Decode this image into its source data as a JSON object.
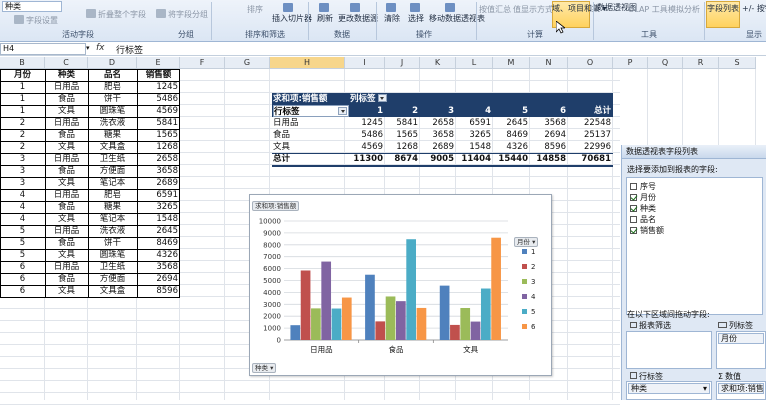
{
  "ribbon": {
    "field_name_value": "种类",
    "items": [
      {
        "label": "字段设置",
        "dim": true
      },
      {
        "label": "折叠整个字段",
        "dim": true
      },
      {
        "label": "将字段分组",
        "dim": true
      },
      {
        "label": "排序",
        "dim": true
      },
      {
        "label": "插入切片器"
      },
      {
        "label": "刷新"
      },
      {
        "label": "更改数据源"
      },
      {
        "label": "清除"
      },
      {
        "label": "选择"
      },
      {
        "label": "移动数据透视表"
      },
      {
        "label": "按值汇总",
        "dim": true
      },
      {
        "label": "值显示方式",
        "dim": true
      },
      {
        "label": "域、项目和集"
      },
      {
        "label": "数据透视图"
      },
      {
        "label": "OLAP 工具",
        "dim": true
      },
      {
        "label": "模拟分析",
        "dim": true
      },
      {
        "label": "字段列表"
      },
      {
        "label": "+/- 按钮"
      }
    ],
    "groups": [
      "活动字段",
      "分组",
      "排序和筛选",
      "数据",
      "操作",
      "计算",
      "工具",
      "显示"
    ]
  },
  "formula_bar": {
    "name_box": "H4",
    "fx": "fx",
    "content": "行标签"
  },
  "columns": [
    "B",
    "C",
    "D",
    "E",
    "F",
    "G",
    "H",
    "I",
    "J",
    "K",
    "L",
    "M",
    "N",
    "O",
    "P",
    "Q",
    "R",
    "S"
  ],
  "source_table": {
    "headers": [
      "月份",
      "种类",
      "品名",
      "销售额"
    ],
    "rows": [
      [
        "1",
        "日用品",
        "肥皂",
        "1245"
      ],
      [
        "1",
        "食品",
        "饼干",
        "5486"
      ],
      [
        "1",
        "文具",
        "圆珠笔",
        "4569"
      ],
      [
        "2",
        "日用品",
        "洗衣液",
        "5841"
      ],
      [
        "2",
        "食品",
        "糖果",
        "1565"
      ],
      [
        "2",
        "文具",
        "文具盒",
        "1268"
      ],
      [
        "3",
        "日用品",
        "卫生纸",
        "2658"
      ],
      [
        "3",
        "食品",
        "方便面",
        "3658"
      ],
      [
        "3",
        "文具",
        "笔记本",
        "2689"
      ],
      [
        "4",
        "日用品",
        "肥皂",
        "6591"
      ],
      [
        "4",
        "食品",
        "糖果",
        "3265"
      ],
      [
        "4",
        "文具",
        "笔记本",
        "1548"
      ],
      [
        "5",
        "日用品",
        "洗衣液",
        "2645"
      ],
      [
        "5",
        "食品",
        "饼干",
        "8469"
      ],
      [
        "5",
        "文具",
        "圆珠笔",
        "4326"
      ],
      [
        "6",
        "日用品",
        "卫生纸",
        "3568"
      ],
      [
        "6",
        "食品",
        "方便面",
        "2694"
      ],
      [
        "6",
        "文具",
        "文具盒",
        "8596"
      ]
    ]
  },
  "pivot": {
    "corner": "求和项:销售额",
    "col_label": "列标签",
    "row_label": "行标签",
    "col_headers": [
      "1",
      "2",
      "3",
      "4",
      "5",
      "6",
      "总计"
    ],
    "rows": [
      {
        "label": "日用品",
        "values": [
          "1245",
          "5841",
          "2658",
          "6591",
          "2645",
          "3568",
          "22548"
        ]
      },
      {
        "label": "食品",
        "values": [
          "5486",
          "1565",
          "3658",
          "3265",
          "8469",
          "2694",
          "25137"
        ]
      },
      {
        "label": "文具",
        "values": [
          "4569",
          "1268",
          "2689",
          "1548",
          "4326",
          "8596",
          "22996"
        ]
      }
    ],
    "total": {
      "label": "总计",
      "values": [
        "11300",
        "8674",
        "9005",
        "11404",
        "15440",
        "14858",
        "70681"
      ]
    }
  },
  "chart_data": {
    "type": "bar",
    "title": "",
    "value_field_button": "求和项:销售额",
    "axis_field_button": "种类",
    "legend_field_button": "月份",
    "categories": [
      "日用品",
      "食品",
      "文具"
    ],
    "series": [
      {
        "name": "1",
        "color": "#4f81bd",
        "values": [
          1245,
          5486,
          4569
        ]
      },
      {
        "name": "2",
        "color": "#c0504d",
        "values": [
          5841,
          1565,
          1268
        ]
      },
      {
        "name": "3",
        "color": "#9bbb59",
        "values": [
          2658,
          3658,
          2689
        ]
      },
      {
        "name": "4",
        "color": "#8064a2",
        "values": [
          6591,
          3265,
          1548
        ]
      },
      {
        "name": "5",
        "color": "#4bacc6",
        "values": [
          2645,
          8469,
          4326
        ]
      },
      {
        "name": "6",
        "color": "#f79646",
        "values": [
          3568,
          2694,
          8596
        ]
      }
    ],
    "yticks": [
      "0",
      "1000",
      "2000",
      "3000",
      "4000",
      "5000",
      "6000",
      "7000",
      "8000",
      "9000",
      "10000"
    ],
    "ylim": [
      0,
      10000
    ],
    "grid": true,
    "legend": "right"
  },
  "field_list": {
    "title": "数据透视表字段列表",
    "prompt": "选择要添加到报表的字段:",
    "fields": [
      {
        "label": "序号",
        "checked": false
      },
      {
        "label": "月份",
        "checked": true
      },
      {
        "label": "种类",
        "checked": true
      },
      {
        "label": "品名",
        "checked": false
      },
      {
        "label": "销售额",
        "checked": true
      }
    ],
    "drag_prompt": "在以下区域间拖动字段:",
    "zones": {
      "report_filter": "报表筛选",
      "column_labels": "列标签",
      "column_item": "月份",
      "row_labels": "行标签",
      "row_item": "种类",
      "values": "数值",
      "values_item": "求和项:销售额"
    }
  }
}
